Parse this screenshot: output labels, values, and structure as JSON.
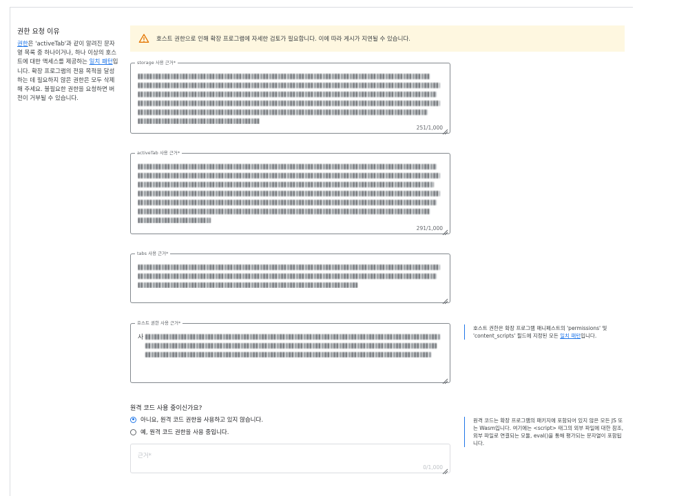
{
  "left": {
    "title": "권한 요청 이유",
    "desc_link1": "권한",
    "desc_part1": "은 'activeTab'과 같이 알려진 문자열 목록 중 하나이거나, 하나 이상의 호스트에 대한 액세스를 제공하는 ",
    "desc_link2": "일치 패턴",
    "desc_part2": "입니다. 확장 프로그램의 전용 목적을 달성하는 데 필요하지 않은 권한은 모두 삭제해 주세요. 불필요한 권한을 요청하면 버전이 거부될 수 있습니다."
  },
  "warning": {
    "icon": "warning-icon",
    "text": "호스트 권한으로 인해 확장 프로그램에 자세한 검토가 필요합니다. 이에 따라 게시가 지연될 수 있습니다.",
    "bg": "#fef7e0",
    "icon_color": "#e37400"
  },
  "fields": {
    "storage": {
      "label": "storage 사용 근거*",
      "count": "251/1,000"
    },
    "activetab": {
      "label": "activeTab 사용 근거*",
      "count": "291/1,000"
    },
    "tabs": {
      "label": "tabs 사용 근거*"
    },
    "host": {
      "label": "호스트 권한 사용 근거*",
      "first_char": "사"
    }
  },
  "host_note": {
    "part1": "호스트 권한은 확장 프로그램 매니페스트의 'permissions' 및 'content_scripts' 필드에 지정된 모든 ",
    "link": "일치 패턴",
    "part2": "입니다."
  },
  "remote": {
    "question": "원격 코드 사용 중이신가요?",
    "option_no": "아니요, 원격 코드 권한을 사용하고 있지 않습니다.",
    "option_yes": "예, 원격 코드 권한을 사용 중입니다.",
    "selected": "no",
    "field_placeholder": "근거*",
    "field_count": "0/1,000",
    "note": "원격 코드는 확장 프로그램의 패키지에 포함되어 있지 않은 모든 JS 또는 Wasm입니다. 여기에는 <script> 태그의 외부 파일에 대한 참조, 외부 파일로 연결되는 모듈, eval()을 통해 평가되는 문자열이 포함됩니다."
  },
  "colors": {
    "accent": "#1a73e8",
    "border": "#80868b"
  }
}
